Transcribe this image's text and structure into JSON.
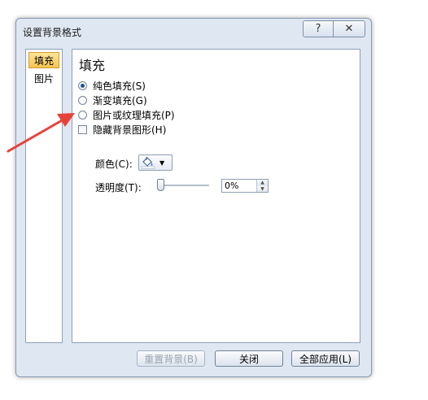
{
  "dialog": {
    "title": "设置背景格式",
    "help_label": "?",
    "close_label": "✕"
  },
  "sidebar": {
    "items": [
      {
        "label": "填充",
        "selected": true
      },
      {
        "label": "图片",
        "selected": false
      }
    ]
  },
  "panel": {
    "section_title": "填充",
    "options": [
      {
        "label": "纯色填充(S)",
        "checked": true
      },
      {
        "label": "渐变填充(G)",
        "checked": false
      },
      {
        "label": "图片或纹理填充(P)",
        "checked": false
      }
    ],
    "hide_bg_label": "隐藏背景图形(H)",
    "color_label": "颜色(C):",
    "transparency_label": "透明度(T):",
    "transparency_value": "0%"
  },
  "footer": {
    "reset_label": "重置背景(B)",
    "close_label": "关闭",
    "apply_all_label": "全部应用(L)"
  },
  "colors": {
    "arrow": "#e8413a",
    "selected_nav": "#f8c650",
    "dialog_bg": "#dfe7f2"
  }
}
